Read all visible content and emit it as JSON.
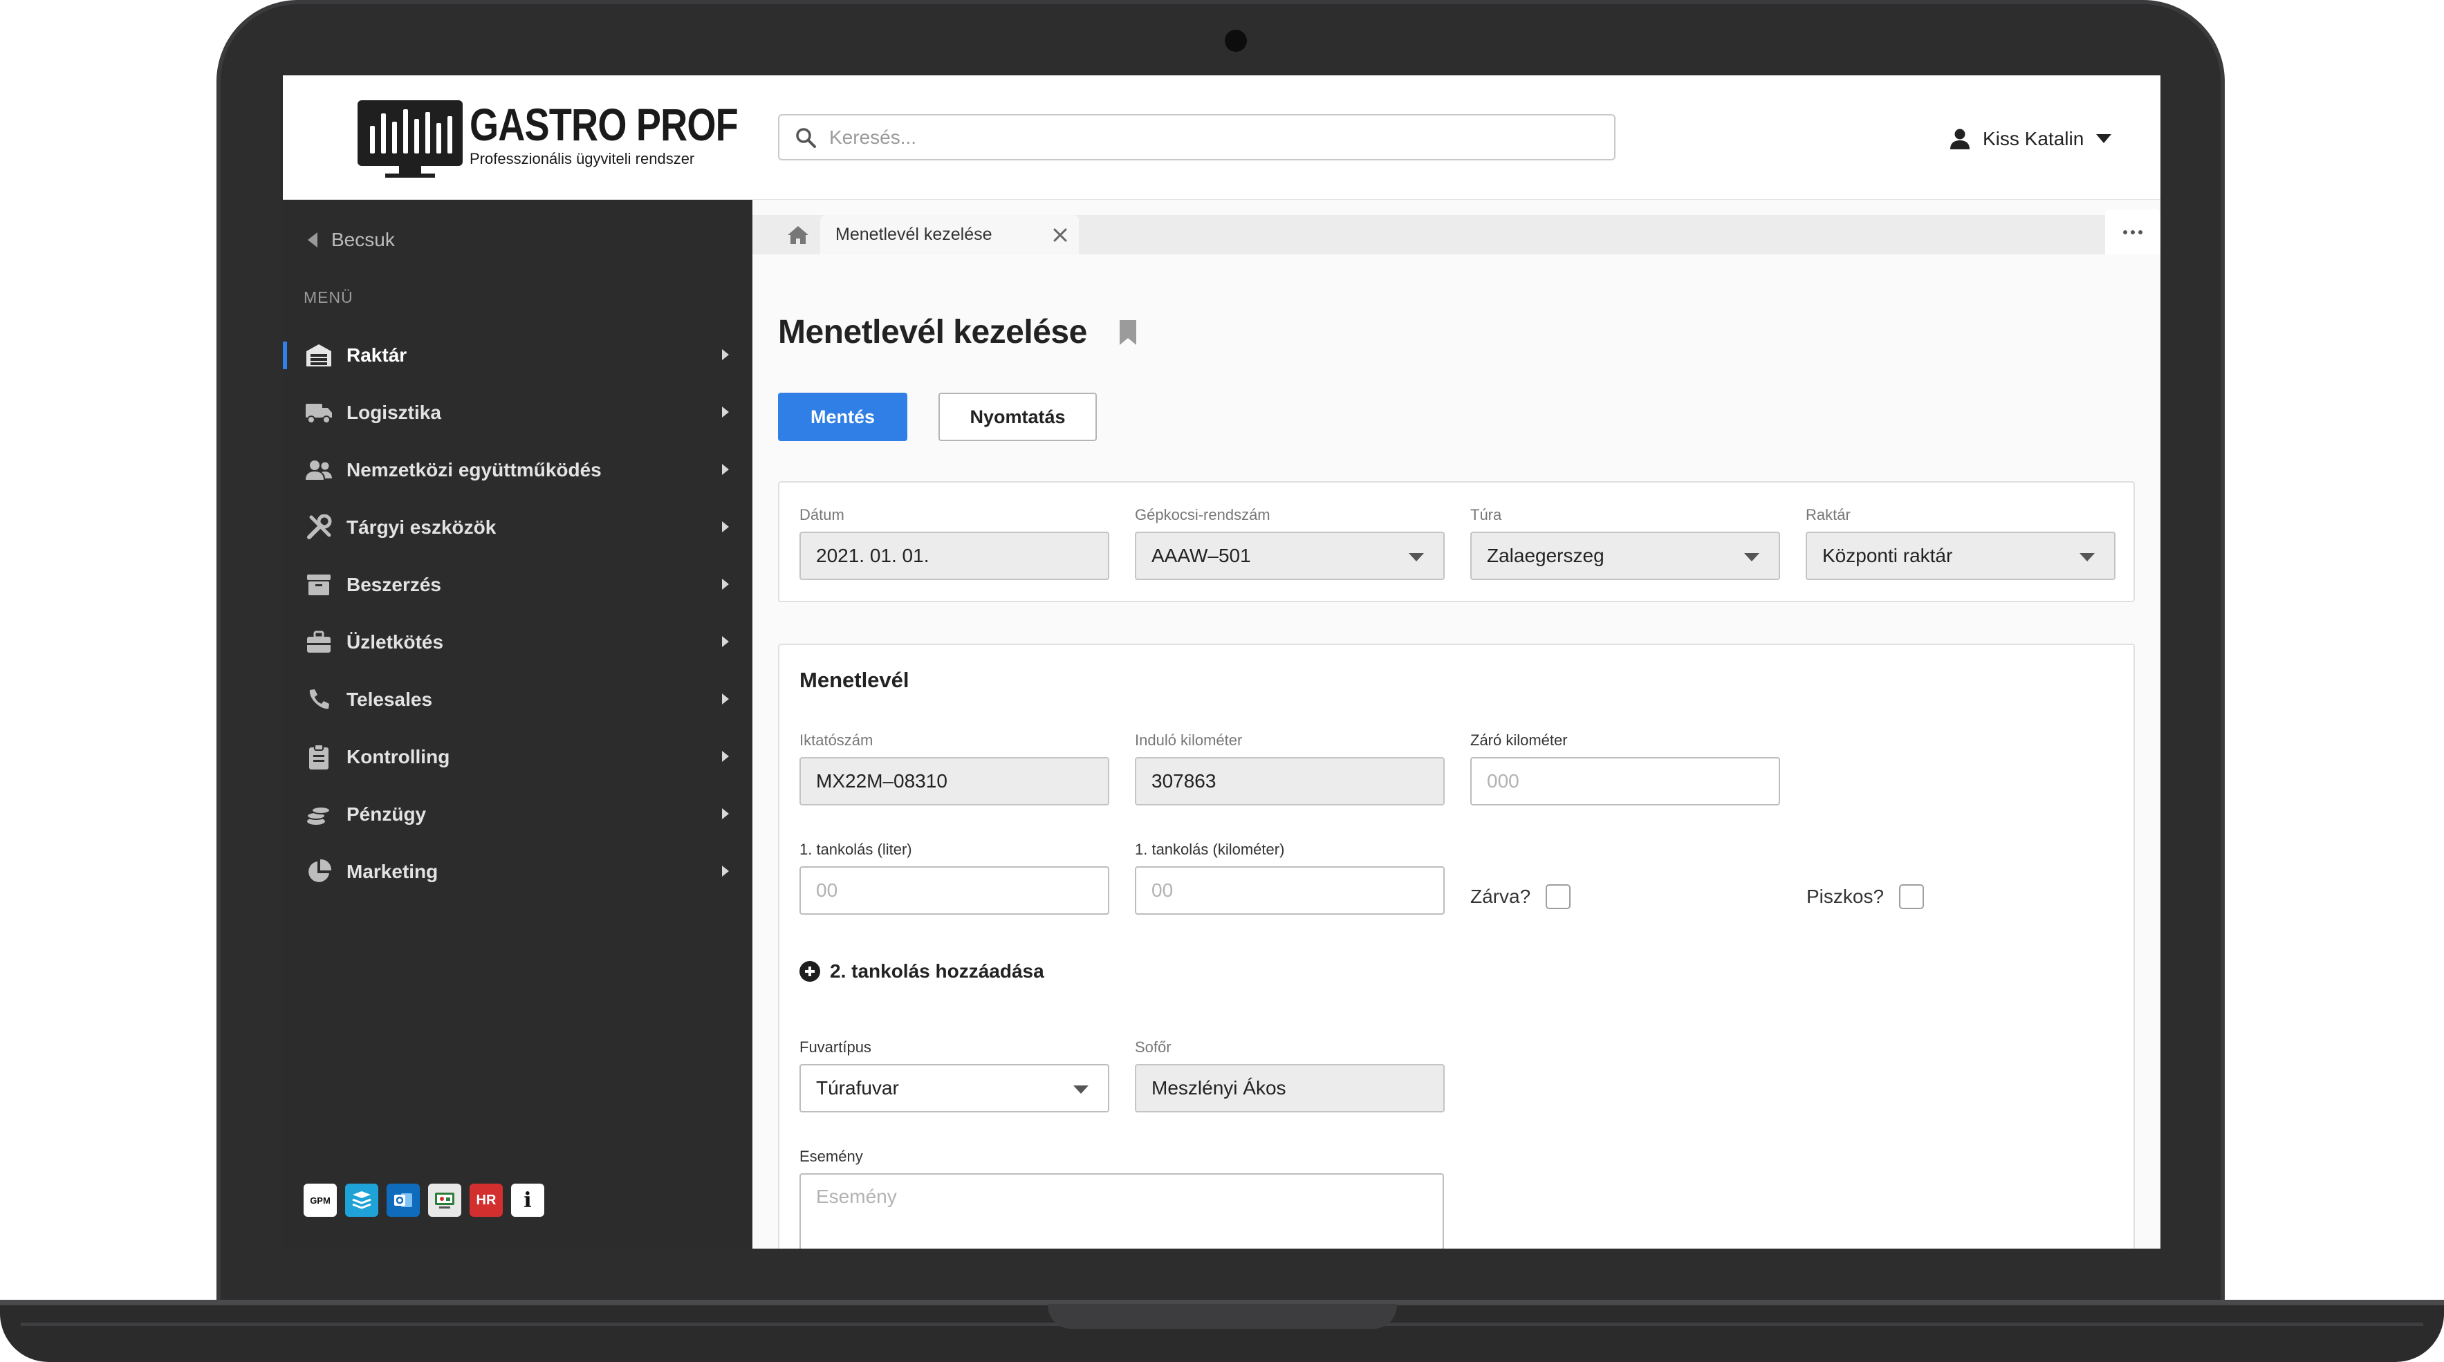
{
  "app": {
    "logo_title": "GASTRO PROF",
    "logo_subtitle": "Professzionális ügyviteli rendszer"
  },
  "header": {
    "search_placeholder": "Keresés...",
    "user_name": "Kiss Katalin"
  },
  "sidebar": {
    "back_label": "Becsuk",
    "menu_label": "MENÜ",
    "items": [
      {
        "label": "Raktár",
        "icon": "warehouse-icon",
        "active": true
      },
      {
        "label": "Logisztika",
        "icon": "truck-icon"
      },
      {
        "label": "Nemzetközi együttműködés",
        "icon": "people-icon"
      },
      {
        "label": "Tárgyi eszközök",
        "icon": "tools-icon"
      },
      {
        "label": "Beszerzés",
        "icon": "box-icon"
      },
      {
        "label": "Üzletkötés",
        "icon": "briefcase-icon"
      },
      {
        "label": "Telesales",
        "icon": "phone-icon"
      },
      {
        "label": "Kontrolling",
        "icon": "clipboard-icon"
      },
      {
        "label": "Pénzügy",
        "icon": "coins-icon"
      },
      {
        "label": "Marketing",
        "icon": "pie-chart-icon"
      }
    ],
    "tools": [
      {
        "label": "GPM",
        "icon": "gpm-app-icon",
        "color": "#ffffff"
      },
      {
        "label": "",
        "icon": "layers-app-icon",
        "color": "#1fa2d8"
      },
      {
        "label": "",
        "icon": "outlook-app-icon",
        "color": "#0f6cbd"
      },
      {
        "label": "",
        "icon": "webshop-app-icon",
        "color": "#e8e8e8"
      },
      {
        "label": "HR",
        "icon": "hr-master-app-icon",
        "color": "#d32f2f"
      },
      {
        "label": "i",
        "icon": "info-app-icon",
        "color": "#ffffff"
      }
    ]
  },
  "tabs": {
    "active_tab": "Menetlevél kezelése"
  },
  "page": {
    "title": "Menetlevél kezelése",
    "save_label": "Mentés",
    "print_label": "Nyomtatás"
  },
  "filters": {
    "date_label": "Dátum",
    "date_value": "2021. 01. 01.",
    "plate_label": "Gépkocsi-rendszám",
    "plate_value": "AAAW–501",
    "tour_label": "Túra",
    "tour_value": "Zalaegerszeg",
    "warehouse_label": "Raktár",
    "warehouse_value": "Központi raktár"
  },
  "waybill": {
    "title": "Menetlevél",
    "ref_label": "Iktatószám",
    "ref_value": "MX22M–08310",
    "start_km_label": "Induló kilométer",
    "start_km_value": "307863",
    "end_km_label": "Záró kilométer",
    "end_km_placeholder": "000",
    "fuel1_liter_label": "1. tankolás (liter)",
    "fuel1_liter_placeholder": "00",
    "fuel1_km_label": "1. tankolás (kilométer)",
    "fuel1_km_placeholder": "00",
    "closed_label": "Zárva?",
    "dirty_label": "Piszkos?",
    "add_fuel_label": "2. tankolás hozzáadása",
    "freight_label": "Fuvartípus",
    "freight_value": "Túrafuvar",
    "driver_label": "Sofőr",
    "driver_value": "Meszlényi Ákos",
    "event_label": "Esemény",
    "event_placeholder": "Esemény"
  },
  "colors": {
    "primary": "#2f7fe6",
    "sidebar_bg": "#2c2c2c",
    "active_indicator": "#2f80ed"
  }
}
